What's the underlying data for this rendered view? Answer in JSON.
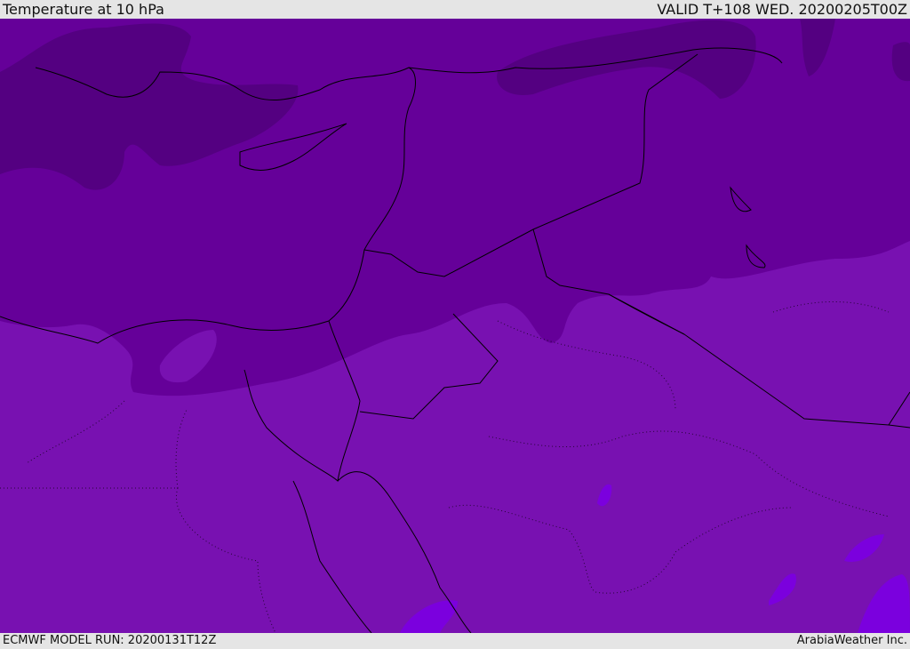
{
  "header": {
    "title": "Temperature at 10 hPa",
    "valid": "VALID T+108 WED. 20200205T00Z"
  },
  "footer": {
    "model_run": "ECMWF MODEL RUN: 20200131T12Z",
    "credit": "ArabiaWeather Inc."
  },
  "colors": {
    "warm_band": "#7811b1",
    "mid_band": "#650099",
    "cold_band": "#540081",
    "warmest": "#7b00de",
    "coast": "#000000"
  }
}
